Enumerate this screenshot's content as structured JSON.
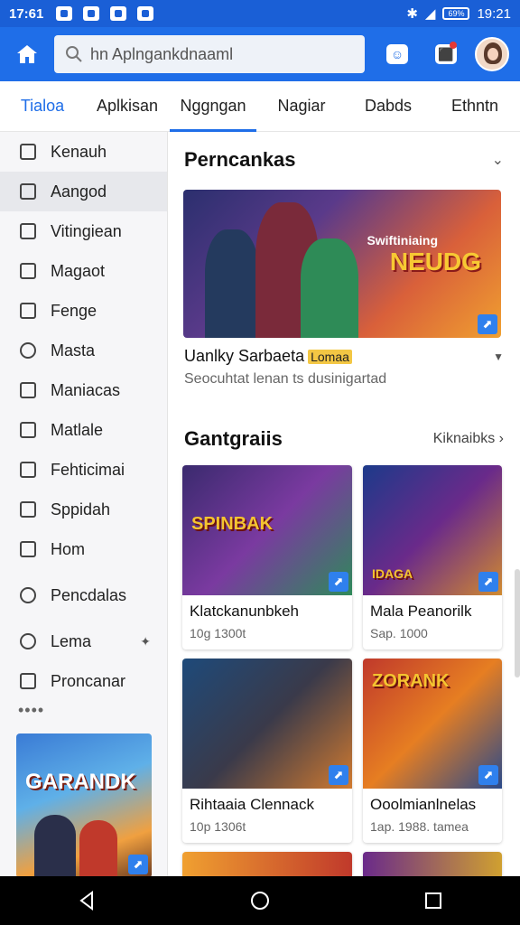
{
  "status_bar": {
    "time": "17:61",
    "right_time": "19:21",
    "battery": "69%",
    "icons": [
      "bluetooth-icon",
      "signal-icon",
      "battery-icon"
    ]
  },
  "header": {
    "search_value": "hn Aplngankdnaaml",
    "icons": [
      "home-icon",
      "search-icon",
      "message-icon",
      "notification-icon",
      "avatar"
    ]
  },
  "tabs": [
    {
      "label": "Tialoa"
    },
    {
      "label": "Aplkisan"
    },
    {
      "label": "Nggngan"
    },
    {
      "label": "Nagiar"
    },
    {
      "label": "Dabds"
    },
    {
      "label": "Ethntn"
    }
  ],
  "sidebar": {
    "items": [
      {
        "label": "Kenauh"
      },
      {
        "label": "Aangod"
      },
      {
        "label": "Vitingiean"
      },
      {
        "label": "Magaot"
      },
      {
        "label": "Fenge"
      },
      {
        "label": "Masta"
      },
      {
        "label": "Maniacas"
      },
      {
        "label": "Matlale"
      },
      {
        "label": "Fehticimai"
      },
      {
        "label": "Sppidah"
      },
      {
        "label": "Hom"
      },
      {
        "label": "Pencdalas"
      },
      {
        "label": "Lema"
      },
      {
        "label": "Proncanar"
      }
    ],
    "more": "••••",
    "promo_title": "GARANDK"
  },
  "featured": {
    "section_title": "Perncankas",
    "hero_logo_small": "Swiftiniaing",
    "hero_logo": "NEUDG",
    "title": "Uanlky Sarbaeta",
    "tag": "Lomaa",
    "subtitle": "Seocuhtat lenan ts dusinigartad"
  },
  "games": {
    "section_title": "Gantgraiis",
    "see_all": "Kiknaibks",
    "cards": [
      {
        "name": "Klatckanunbkeh",
        "meta": "10g 1300t",
        "logo": "SPINBAK"
      },
      {
        "name": "Mala Peanorilk",
        "meta": "Sap. 1000",
        "logo": "IDAGA"
      },
      {
        "name": "Rihtaaia Clennack",
        "meta": "10p 1306t",
        "logo": ""
      },
      {
        "name": "Ooolmianlnelas",
        "meta": "1ap. 1988. tamea",
        "logo": "ZORANK"
      }
    ]
  },
  "colors": {
    "brand": "#1f6ee8",
    "statusbar": "#1a5fd6"
  }
}
